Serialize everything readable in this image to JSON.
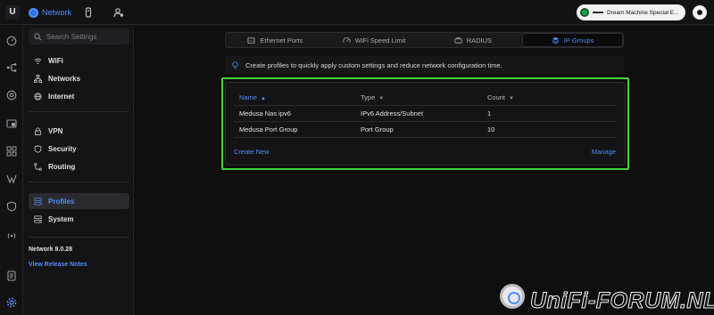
{
  "topbar": {
    "app_label": "Network",
    "device_name": "Dream Machine Special E...",
    "icons": [
      "ubiquiti-logo",
      "network-icon",
      "device-icon",
      "user-settings-icon"
    ]
  },
  "rail": {
    "icons": [
      "dashboard-icon",
      "topology-icon",
      "target-icon",
      "devices-icon",
      "clients-icon",
      "insights-icon",
      "shield-icon",
      "radio-icon",
      "notes-icon",
      "settings-icon"
    ]
  },
  "sidebar": {
    "search_placeholder": "Search Settings",
    "items": [
      {
        "label": "WiFi",
        "icon": "wifi-icon"
      },
      {
        "label": "Networks",
        "icon": "networks-icon"
      },
      {
        "label": "Internet",
        "icon": "globe-icon"
      },
      {
        "label": "VPN",
        "icon": "vpn-icon"
      },
      {
        "label": "Security",
        "icon": "security-icon"
      },
      {
        "label": "Routing",
        "icon": "routing-icon"
      },
      {
        "label": "Profiles",
        "icon": "profiles-icon",
        "active": true
      },
      {
        "label": "System",
        "icon": "system-icon"
      }
    ],
    "version": "Network 8.0.28",
    "release_link": "View Release Notes"
  },
  "tabs": [
    {
      "label": "Ethernet Ports",
      "icon": "ethernet-icon"
    },
    {
      "label": "WiFi Speed Limit",
      "icon": "speed-icon"
    },
    {
      "label": "RADIUS",
      "icon": "radius-icon"
    },
    {
      "label": "IP Groups",
      "icon": "ip-groups-icon",
      "active": true
    }
  ],
  "banner": {
    "text": "Create profiles to quickly apply custom settings and reduce network configuration time."
  },
  "table": {
    "columns": [
      "Name",
      "Type",
      "Count"
    ],
    "rows": [
      {
        "name": "Medusa Nas ipv6",
        "type": "IPv6 Address/Subnet",
        "count": "1"
      },
      {
        "name": "Medusa Port Group",
        "type": "Port Group",
        "count": "10"
      }
    ],
    "create_label": "Create New",
    "manage_label": "Manage"
  },
  "watermark": {
    "text": "UniFi-FORUM.NL"
  },
  "colors": {
    "accent": "#4f8ff7",
    "highlight": "#43d13c",
    "background": "#0f0f10"
  }
}
